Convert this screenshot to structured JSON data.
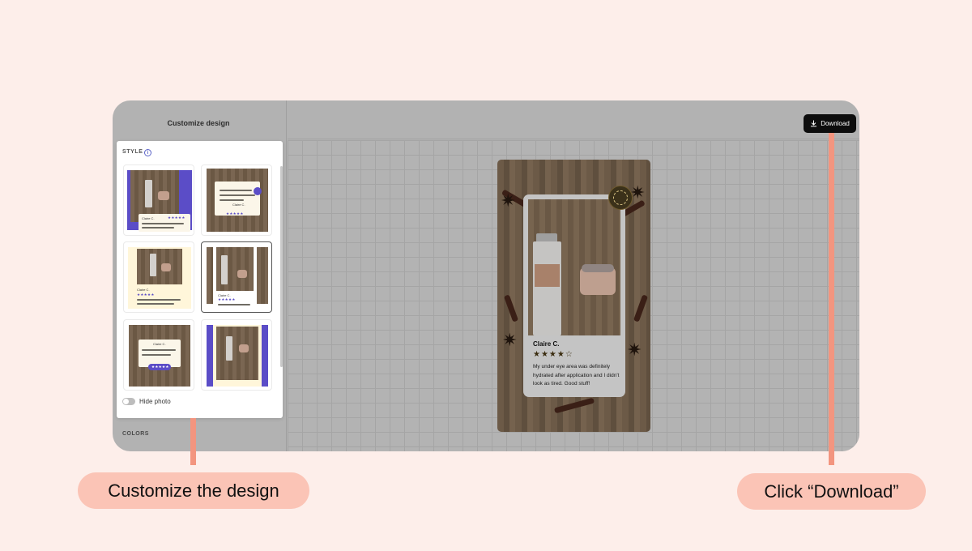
{
  "sidebar": {
    "title": "Customize design",
    "colors_label": "COLORS"
  },
  "style_panel": {
    "label": "STYLE",
    "info_icon": "info-icon",
    "hide_photo_label": "Hide photo",
    "hide_photo_enabled": false,
    "selected_template": 4,
    "templates": [
      {
        "name": "Claire C.",
        "stars": "★★★★★"
      },
      {
        "name": "Claire C.",
        "stars": "★★★★★"
      },
      {
        "name": "Claire C.",
        "stars": "★★★★★"
      },
      {
        "name": "Claire C.",
        "stars": "★★★★★"
      },
      {
        "name": "Claire C.",
        "stars": "★★★★★"
      },
      {
        "name": "",
        "stars": ""
      }
    ]
  },
  "toolbar": {
    "download_label": "Download",
    "download_icon": "download-icon"
  },
  "preview": {
    "review_name": "Claire C.",
    "rating": 4,
    "stars": "★★★★☆",
    "review_text": "My under eye area was definitely hydrated after application and I didn't look as tired. Good stuff!"
  },
  "callouts": {
    "left": "Customize the design",
    "right": "Click “Download”"
  },
  "colors": {
    "page_bg": "#fdeeea",
    "accent": "#f3957f",
    "callout_bg": "#fbc4b6",
    "template_purple": "#5b4dc7"
  }
}
